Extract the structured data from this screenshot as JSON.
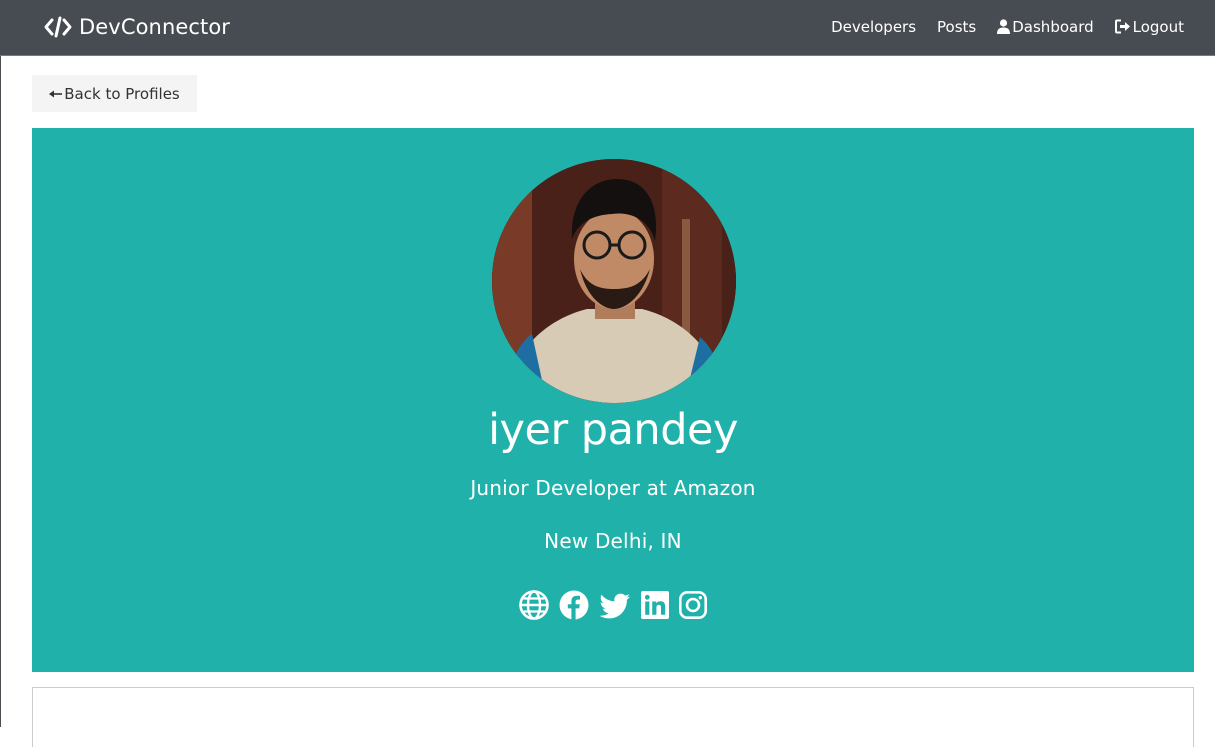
{
  "navbar": {
    "brand": "DevConnector",
    "links": [
      {
        "label": "Developers"
      },
      {
        "label": "Posts"
      },
      {
        "label": "Dashboard"
      },
      {
        "label": "Logout"
      }
    ]
  },
  "back_button": {
    "label": "Back to Profiles"
  },
  "profile": {
    "name": "iyer pandey",
    "title": "Junior Developer at Amazon",
    "location": "New Delhi, IN",
    "social_icons": [
      "globe-icon",
      "facebook-icon",
      "twitter-icon",
      "linkedin-icon",
      "instagram-icon"
    ]
  },
  "colors": {
    "navbar": "#474c52",
    "primary": "#20b2aa",
    "light": "#f4f4f4"
  }
}
